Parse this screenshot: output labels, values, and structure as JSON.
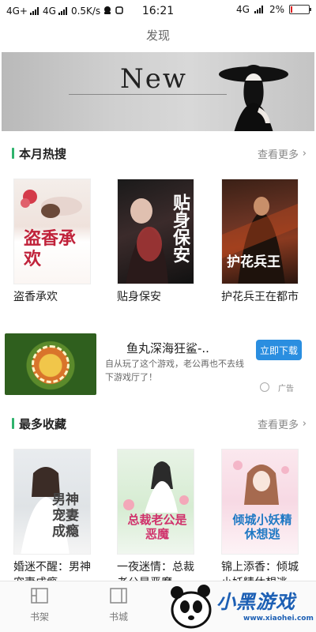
{
  "status_bar": {
    "network1": "4G+",
    "network2": "4G",
    "speed": "0.5K/s",
    "time": "16:21",
    "network_right": "4G",
    "battery": "2%"
  },
  "page_title": "发现",
  "banner": {
    "logo_text": "New",
    "active_slide": 1,
    "slide_count": 4
  },
  "section_monthly": {
    "title": "本月热搜",
    "more": "查看更多",
    "books": [
      {
        "title": "盗香承欢",
        "cover_text": "盗香承欢"
      },
      {
        "title": "贴身保安",
        "cover_text": "贴身保安"
      },
      {
        "title": "护花兵王在都市",
        "cover_text": "护花兵王"
      }
    ]
  },
  "ad": {
    "title": "鱼丸深海狂鲨-..",
    "description": "自从玩了这个游戏，老公再也不去线下游戏厅了！",
    "cta": "立即下载",
    "badge": "广告"
  },
  "section_fav": {
    "title": "最多收藏",
    "more": "查看更多",
    "books": [
      {
        "title": "婚迷不醒：男神宠妻成瘾",
        "cover_text": "男神宠妻成瘾"
      },
      {
        "title": "一夜迷情：总裁老公是恶魔",
        "cover_text": "总裁老公是恶魔"
      },
      {
        "title": "锦上添香：倾城小妖精休想逃",
        "cover_text": "倾城小妖精休想逃"
      }
    ]
  },
  "tab_bar": {
    "tabs": [
      {
        "label": "书架",
        "icon": "bookshelf-icon"
      },
      {
        "label": "书城",
        "icon": "bookstore-icon"
      }
    ]
  },
  "watermark": {
    "text": "小黑游戏",
    "url": "www.xiaohei.com"
  }
}
